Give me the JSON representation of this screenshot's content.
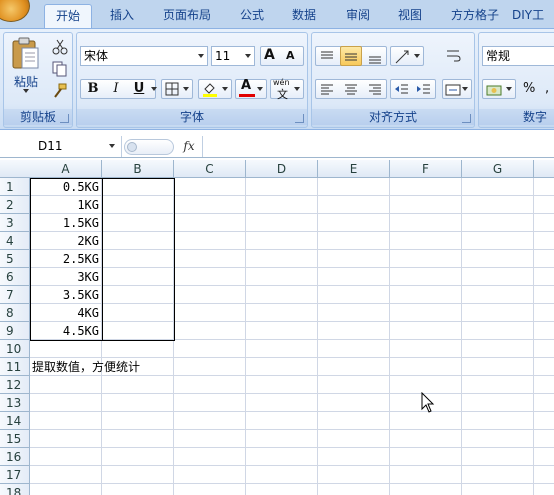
{
  "ribbon_tabs": [
    "开始",
    "插入",
    "页面布局",
    "公式",
    "数据",
    "审阅",
    "视图",
    "方方格子",
    "DIY工"
  ],
  "clipboard": {
    "paste_label": "粘贴",
    "group_label": "剪贴板"
  },
  "font": {
    "name": "宋体",
    "size": "11",
    "bold": "B",
    "italic": "I",
    "underline": "U",
    "font_color_glyph": "A",
    "phonetic_glyph": "wén",
    "grow_glyph": "A",
    "shrink_glyph": "A",
    "group_label": "字体"
  },
  "alignment": {
    "group_label": "对齐方式"
  },
  "number": {
    "format": "常规",
    "percent": "%",
    "group_label": "数字"
  },
  "formula_bar": {
    "name_box": "D11",
    "fx": "fx",
    "content": ""
  },
  "columns": [
    "A",
    "B",
    "C",
    "D",
    "E",
    "F",
    "G"
  ],
  "rows": [
    "1",
    "2",
    "3",
    "4",
    "5",
    "6",
    "7",
    "8",
    "9",
    "10",
    "11",
    "12",
    "13",
    "14",
    "15",
    "16",
    "17",
    "18"
  ],
  "cells": {
    "A1": "0.5KG",
    "A2": "1KG",
    "A3": "1.5KG",
    "A4": "2KG",
    "A5": "2.5KG",
    "A6": "3KG",
    "A7": "3.5KG",
    "A8": "4KG",
    "A9": "4.5KG",
    "A11": "提取数值，方便统计"
  },
  "colors": {
    "ribbon_bg": "#d8e6f7",
    "tab_strip": "#bfd5ee",
    "header_border": "#9eb6ce",
    "accent_text": "#15428b"
  }
}
